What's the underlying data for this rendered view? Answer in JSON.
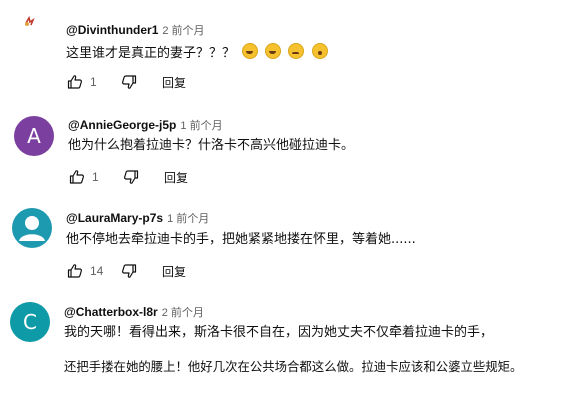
{
  "comments": [
    {
      "handle": "@Divinthunder1",
      "time": "2 前个月",
      "text": "这里谁才是真正的妻子？？？",
      "emojis": [
        "laughing-crying",
        "laughing-crying",
        "sad-crying",
        "surprised"
      ],
      "likes": "1",
      "reply_label": "回复",
      "avatar_letter": "",
      "avatar_color": "#ffffff"
    },
    {
      "handle": "@AnnieGeorge-j5p",
      "time": "1 前个月",
      "text": "他为什么抱着拉迪卡？什洛卡不高兴他碰拉迪卡。",
      "likes": "1",
      "reply_label": "回复",
      "avatar_letter": "A",
      "avatar_color": "#7b3fa0"
    },
    {
      "handle": "@LauraMary-p7s",
      "time": "1 前个月",
      "text": "他不停地去牵拉迪卡的手，把她紧紧地搂在怀里，等着她......",
      "likes": "14",
      "reply_label": "回复",
      "avatar_letter": "",
      "avatar_color": "#1e9ab0"
    },
    {
      "handle": "@Chatterbox-l8r",
      "time": "2 前个月",
      "text": "我的天哪！看得出来，斯洛卡很不自在，因为她丈夫不仅牵着拉迪卡的手，",
      "text2": "还把手搂在她的腰上！他好几次在公共场合都这么做。拉迪卡应该和公婆立些规矩。",
      "avatar_letter": "C",
      "avatar_color": "#0f9aa8"
    }
  ]
}
